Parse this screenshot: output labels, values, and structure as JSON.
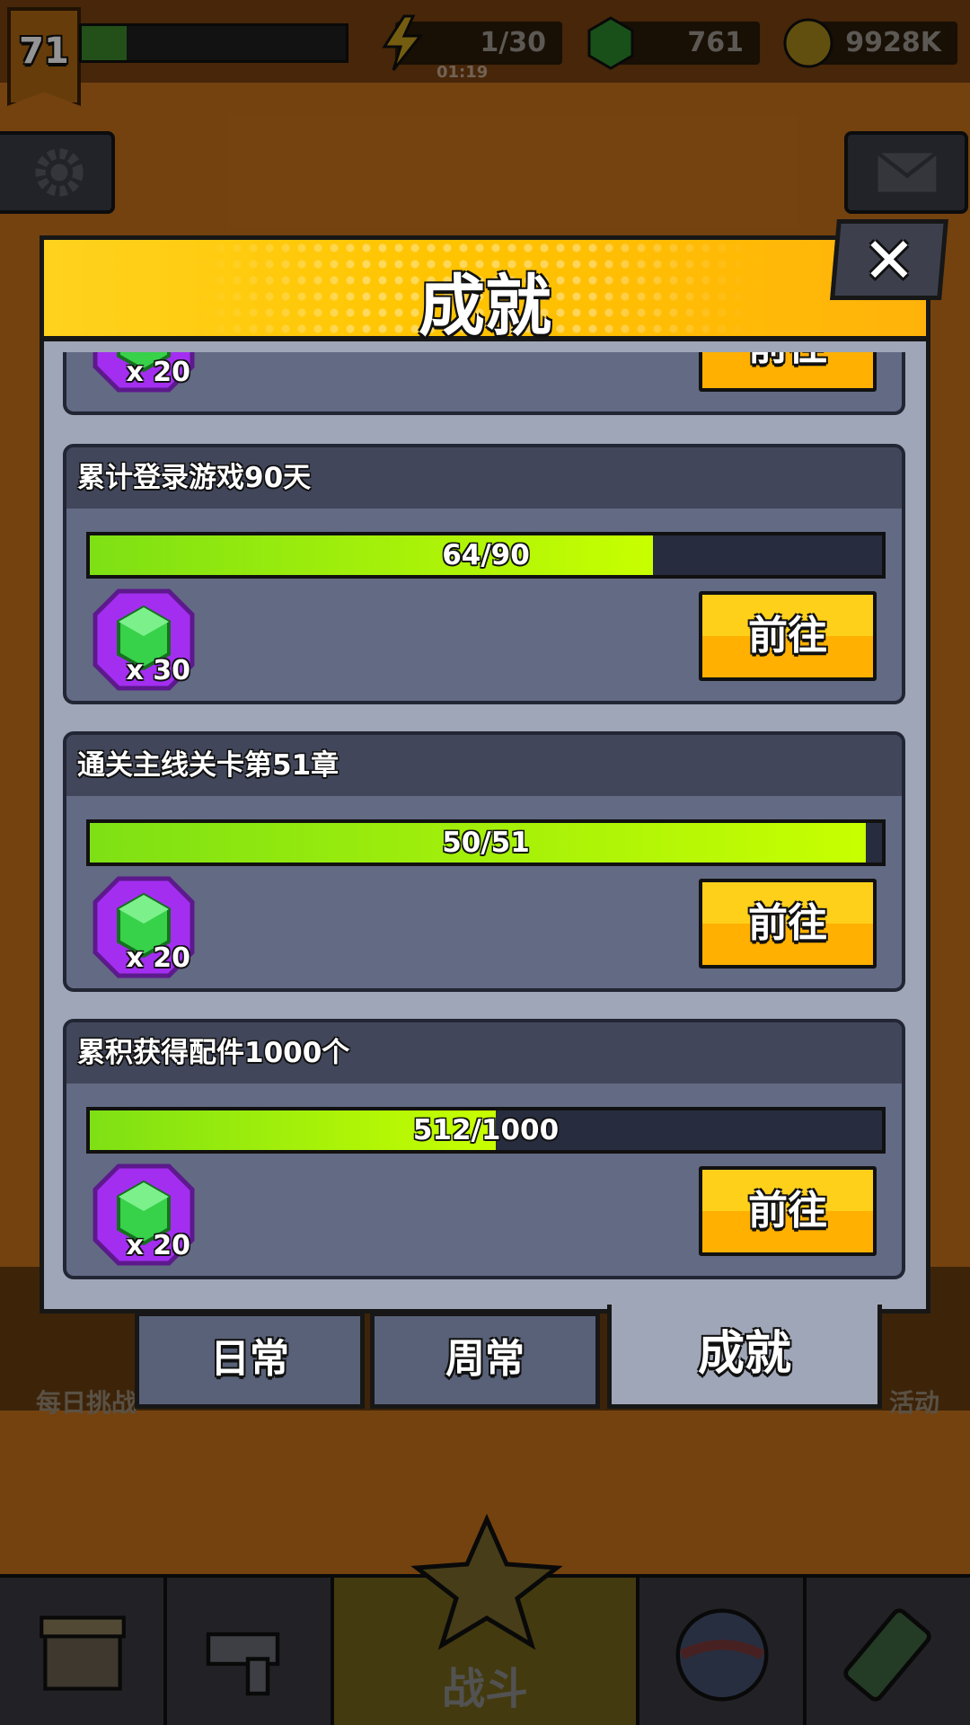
{
  "topbar": {
    "level": "71",
    "xp_progress": 0.17,
    "energy": "1/30",
    "energy_timer": "01:19",
    "gems": "761",
    "coins": "9928K"
  },
  "background": {
    "daily_challenge_label": "每日挑战",
    "event_label_partial": "活动",
    "battle_label": "战斗"
  },
  "modal": {
    "title": "成就",
    "close_label": "✕",
    "achievements": [
      {
        "title": "",
        "progress_text": "",
        "progress": 0,
        "reward_qty": "x 20",
        "button": "前往"
      },
      {
        "title": "累计登录游戏90天",
        "progress_text": "64/90",
        "progress": 0.711,
        "reward_qty": "x 30",
        "button": "前往"
      },
      {
        "title": "通关主线关卡第51章",
        "progress_text": "50/51",
        "progress": 0.98,
        "reward_qty": "x 20",
        "button": "前往"
      },
      {
        "title": "累积获得配件1000个",
        "progress_text": "512/1000",
        "progress": 0.512,
        "reward_qty": "x 20",
        "button": "前往"
      }
    ],
    "tabs": [
      {
        "label": "日常",
        "active": false
      },
      {
        "label": "周常",
        "active": false
      },
      {
        "label": "成就",
        "active": true
      }
    ]
  },
  "colors": {
    "header_yellow": "#ffc400",
    "progress_green": "#a6f00a",
    "button_yellow": "#ffc000",
    "panel_gray": "#9fa6b7",
    "card_bg": "#636a84"
  },
  "icons": {
    "reward": "green-gem-icon",
    "energy": "lightning-icon",
    "gem": "gem-icon",
    "coin": "coin-icon",
    "settings": "gear-icon",
    "mail": "mail-icon"
  }
}
